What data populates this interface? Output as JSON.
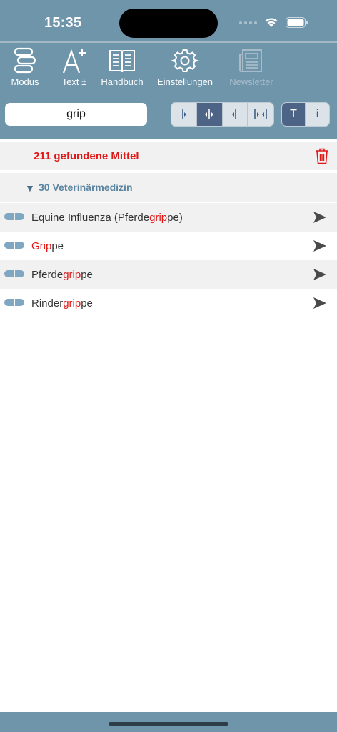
{
  "status": {
    "time": "15:35"
  },
  "toolbar": {
    "modus": "Modus",
    "text": "Text ±",
    "handbuch": "Handbuch",
    "einstellungen": "Einstellungen",
    "newsletter": "Newsletter"
  },
  "search": {
    "value": "grip"
  },
  "mode_toggle": {
    "t": "T",
    "i": "i"
  },
  "results": {
    "count_text": "211 gefundene Mittel",
    "group": "30 Veterinärmedizin",
    "items": [
      {
        "pre": "Equine Influenza (Pferde",
        "hl": "grip",
        "post": "pe)"
      },
      {
        "pre": "",
        "hl": "Grip",
        "post": "pe"
      },
      {
        "pre": "Pferde",
        "hl": "grip",
        "post": "pe"
      },
      {
        "pre": "Rinder",
        "hl": "grip",
        "post": "pe"
      }
    ]
  },
  "colors": {
    "bar": "#6f95ab",
    "highlight": "#e01818",
    "segment_active": "#4e6487",
    "pill": "#7fa7c2"
  }
}
